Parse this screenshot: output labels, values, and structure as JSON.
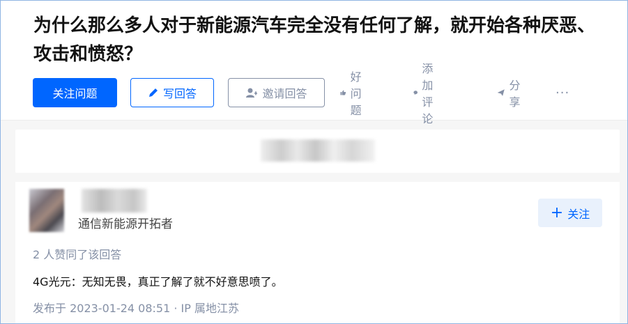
{
  "question": {
    "title": "为什么那么多人对于新能源汽车完全没有任何了解，就开始各种厌恶、攻击和愤怒？"
  },
  "actions": {
    "follow_label": "关注问题",
    "write_label": "写回答",
    "invite_label": "邀请回答",
    "good_label": "好问题",
    "comment_label": "添加评论",
    "share_label": "分享",
    "more_label": "···"
  },
  "answer": {
    "author_bio": "通信新能源开拓者",
    "follow_label": "关注",
    "likes_text": "2 人赞同了该回答",
    "content": "4G光元：无知无畏，真正了解了就不好意思喷了。",
    "meta": "发布于 2023-01-24 08:51 · IP 属地江苏"
  },
  "colors": {
    "brand": "#0066ff",
    "muted": "#8590a6",
    "text": "#121212"
  }
}
